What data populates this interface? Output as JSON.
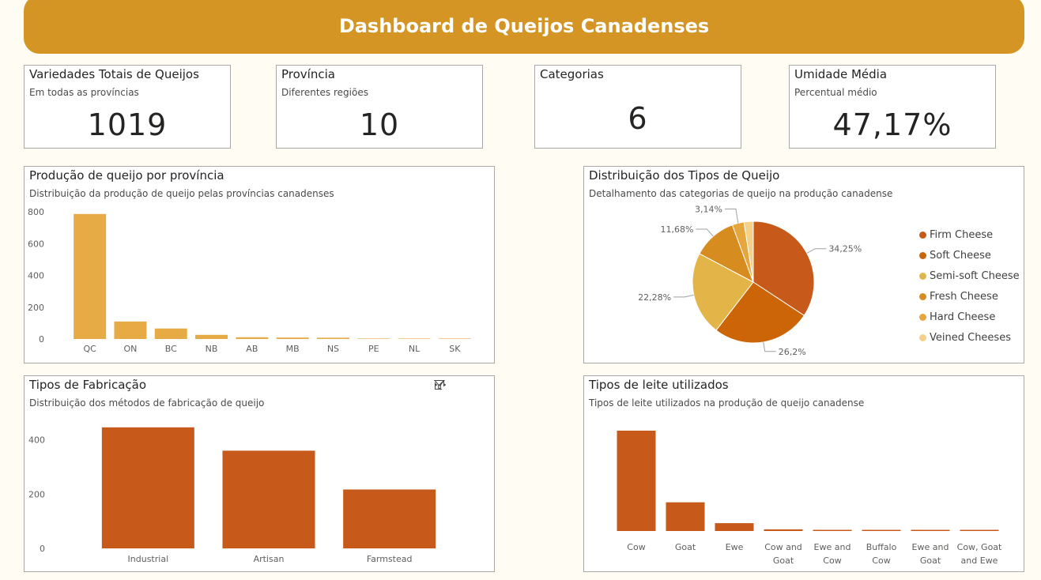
{
  "header": {
    "title": "Dashboard de Queijos Canadenses"
  },
  "kpis": [
    {
      "title": "Variedades Totais de Queijos",
      "subtitle": "Em todas as províncias",
      "value": "1019"
    },
    {
      "title": "Província",
      "subtitle": "Diferentes regiões",
      "value": "10"
    },
    {
      "title": "Categorias",
      "subtitle": "",
      "value": "6"
    },
    {
      "title": "Umidade Média",
      "subtitle": "Percentual médio",
      "value": "47,17%"
    }
  ],
  "panels": {
    "province": {
      "title": "Produção de queijo por província",
      "subtitle": "Distribuição da produção de queijo pelas províncias canadenses"
    },
    "types": {
      "title": "Distribuição dos Tipos de Queijo",
      "subtitle": "Detalhamento das categorias de queijo na produção canadense"
    },
    "manufacturing": {
      "title": "Tipos de Fabricação",
      "subtitle": "Distribuição dos métodos de fabricação de queijo"
    },
    "milk": {
      "title": "Tipos de leite utilizados",
      "subtitle": "Tipos de leite utilizados na produção de queijo canadense"
    }
  },
  "icons": {
    "filter": "filter-icon",
    "focus": "focus-mode-icon",
    "more": "more-options-icon"
  },
  "colors": {
    "banner": "#d49525",
    "province_bar": "#e6ab45",
    "orange_bar": "#c75a1a",
    "background": "#fffcf3"
  },
  "chart_data": [
    {
      "id": "province",
      "type": "bar",
      "categories": [
        "QC",
        "ON",
        "BC",
        "NB",
        "AB",
        "MB",
        "NS",
        "PE",
        "NL",
        "SK"
      ],
      "values": [
        786,
        110,
        66,
        26,
        11,
        9,
        8,
        3,
        3,
        3
      ],
      "ylim": [
        0,
        800
      ],
      "yticks": [
        0,
        200,
        400,
        600,
        800
      ],
      "grid": false
    },
    {
      "id": "types",
      "type": "pie",
      "labels": [
        "Firm Cheese",
        "Soft Cheese",
        "Semi-soft Cheese",
        "Fresh Cheese",
        "Hard Cheese",
        "Veined Cheeses"
      ],
      "values": [
        34.25,
        26.2,
        22.28,
        11.68,
        3.14,
        2.45
      ],
      "data_labels": [
        "34,25%",
        "26,2%",
        "22,28%",
        "11,68%",
        "3,14%",
        ""
      ],
      "colors": [
        "#c75a1a",
        "#cc6508",
        "#e3b548",
        "#d68c1f",
        "#e6a63e",
        "#f3d18b"
      ],
      "legend_position": "right"
    },
    {
      "id": "manufacturing",
      "type": "bar",
      "categories": [
        "Industrial",
        "Artisan",
        "Farmstead"
      ],
      "values": [
        446,
        360,
        217
      ],
      "ylim": [
        0,
        460
      ],
      "yticks": [
        0,
        200,
        400
      ],
      "grid": false
    },
    {
      "id": "milk",
      "type": "bar",
      "categories": [
        [
          "Cow"
        ],
        [
          "Goat"
        ],
        [
          "Ewe"
        ],
        [
          "Cow and",
          "Goat"
        ],
        [
          "Ewe and",
          "Cow"
        ],
        [
          "Buffalo",
          "Cow"
        ],
        [
          "Ewe and",
          "Goat"
        ],
        [
          "Cow, Goat",
          "and Ewe"
        ]
      ],
      "values": [
        601,
        172,
        47,
        10,
        4,
        3,
        3,
        3
      ],
      "ylim": [
        0,
        601
      ],
      "grid": false
    }
  ]
}
